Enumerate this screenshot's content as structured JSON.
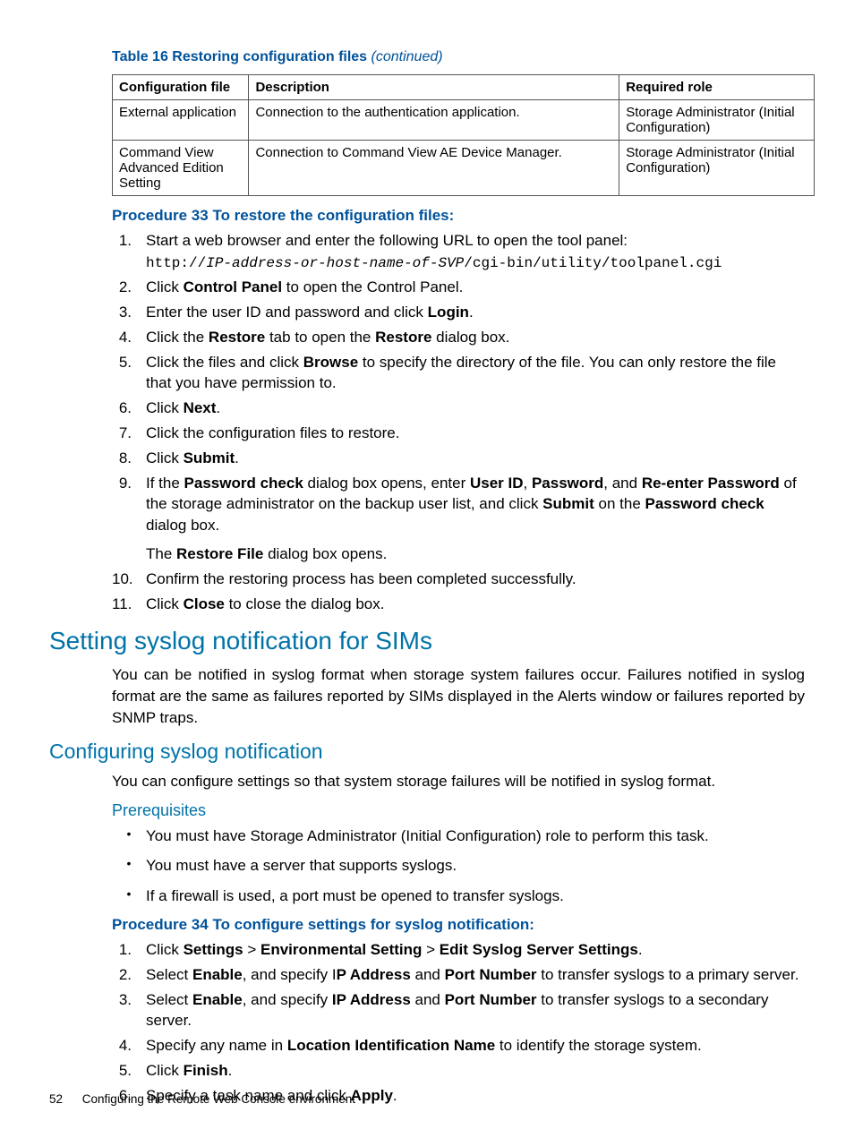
{
  "table": {
    "title_prefix": "Table 16 Restoring configuration files ",
    "title_suffix": "(continued)",
    "headers": [
      "Configuration file",
      "Description",
      "Required role"
    ],
    "rows": [
      [
        "External application",
        "Connection to the authentication application.",
        "Storage Administrator (Initial Configuration)"
      ],
      [
        "Command View Advanced Edition Setting",
        "Connection to Command View AE Device Manager.",
        "Storage Administrator (Initial Configuration)"
      ]
    ]
  },
  "proc33": {
    "title": "Procedure 33 To restore the configuration files:",
    "url_prefix": "http://",
    "url_mid": "IP-address-or-host-name-of-SVP",
    "url_suffix": "/cgi-bin/utility/toolpanel.cgi"
  },
  "h2": "Setting syslog notification for SIMs",
  "p_h2": "You can be notified in syslog format when storage system failures occur. Failures notified in syslog format are the same as failures reported by SIMs displayed in the Alerts window or failures reported by SNMP traps.",
  "h3": "Configuring syslog notification",
  "p_h3": "You can configure settings so that system storage failures will be notified in syslog format.",
  "h4": "Prerequisites",
  "bullets": [
    "You must have Storage Administrator (Initial Configuration) role to perform this task.",
    "You must have a server that supports syslogs.",
    "If a firewall is used, a port must be opened to transfer syslogs."
  ],
  "proc34": {
    "title": "Procedure 34 To configure settings for syslog notification:"
  },
  "footer": {
    "page": "52",
    "text": "Configuring the Remote Web Console environment"
  }
}
